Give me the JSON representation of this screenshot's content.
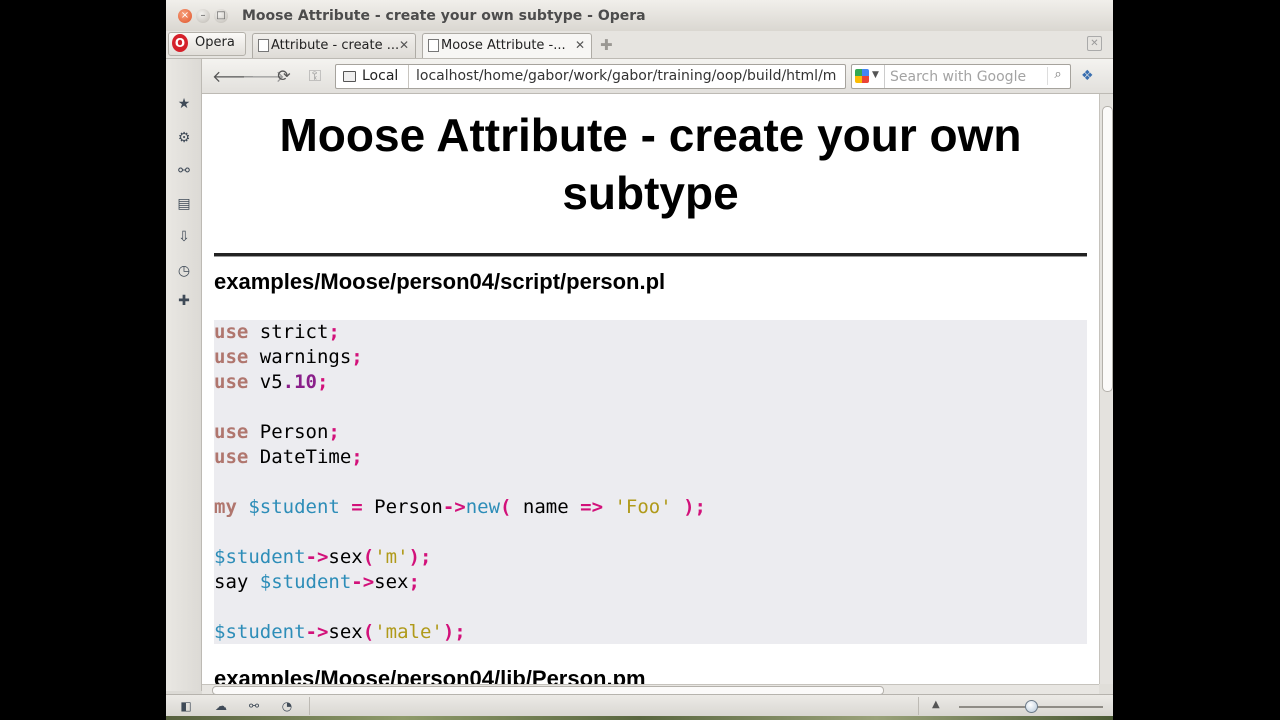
{
  "window": {
    "title": "Moose Attribute - create your own subtype - Opera"
  },
  "tabs": {
    "opera_label": "Opera",
    "items": [
      {
        "label": "Attribute - create ..."
      },
      {
        "label": "Moose Attribute -..."
      }
    ]
  },
  "toolbar": {
    "location_label": "Local",
    "url": "localhost/home/gabor/work/gabor/training/oop/build/html/m",
    "search_placeholder": "Search with Google"
  },
  "page": {
    "heading_line1": "Moose Attribute - create your own",
    "heading_line2": "subtype",
    "file1": "examples/Moose/person04/script/person.pl",
    "file2": "examples/Moose/person04/lib/Person.pm"
  },
  "code": {
    "l1": {
      "kw": "use",
      "t": " strict",
      "p": ";"
    },
    "l2": {
      "kw": "use",
      "t": " warnings",
      "p": ";"
    },
    "l3": {
      "kw": "use",
      "t": " v5",
      "n": ".10",
      "p": ";"
    },
    "l5": {
      "kw": "use",
      "t": " Person",
      "p": ";"
    },
    "l6": {
      "kw": "use",
      "t": " DateTime",
      "p": ";"
    },
    "l8": {
      "kw": "my",
      "v": " $student",
      "eq": " = ",
      "cls": "Person",
      "arrow": "->",
      "fn": "new",
      "po": "(",
      "arg": " name ",
      "fat": "=>",
      "s": " 'Foo'",
      "pc": " );"
    },
    "l10": {
      "v": "$student",
      "arrow": "->",
      "fn": "sex",
      "po": "(",
      "s": "'m'",
      "pc": ");"
    },
    "l11": {
      "t": "say ",
      "v": "$student",
      "arrow": "->",
      "fn": "sex",
      "p": ";"
    },
    "l13": {
      "v": "$student",
      "arrow": "->",
      "fn": "sex",
      "po": "(",
      "s": "'male'",
      "pc": ");"
    }
  }
}
